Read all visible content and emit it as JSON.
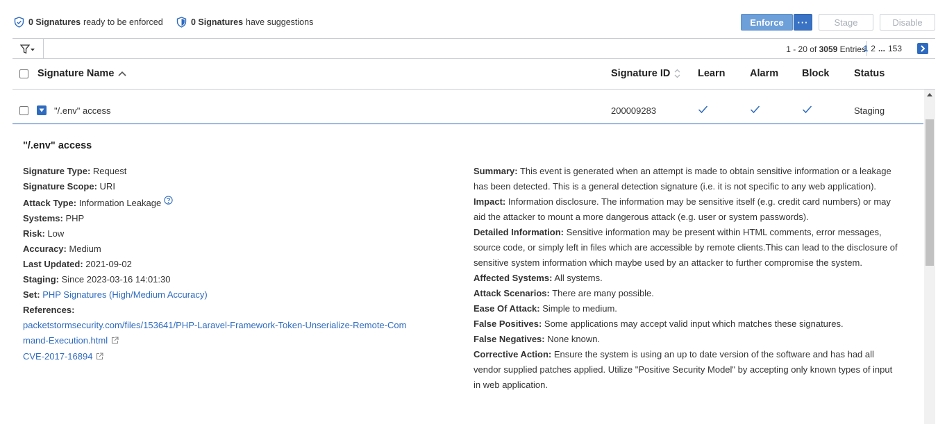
{
  "summary": {
    "ready_count": "0 Signatures",
    "ready_text": "ready to be enforced",
    "suggest_count": "0 Signatures",
    "suggest_text": "have suggestions"
  },
  "toolbar": {
    "enforce_label": "Enforce",
    "more_label": "···",
    "stage_label": "Stage",
    "disable_label": "Disable"
  },
  "pagination": {
    "range": "1 - 20 of",
    "total": "3059",
    "entries_label": "Entries",
    "pages": [
      "1",
      "2",
      "...",
      "153"
    ],
    "current_page": "1"
  },
  "columns": {
    "name": "Signature Name",
    "id": "Signature ID",
    "learn": "Learn",
    "alarm": "Alarm",
    "block": "Block",
    "status": "Status"
  },
  "row": {
    "name": "\"/.env\" access",
    "id": "200009283",
    "learn": true,
    "alarm": true,
    "block": true,
    "status": "Staging"
  },
  "details": {
    "title": "\"/.env\" access",
    "left": [
      {
        "label": "Signature Type:",
        "value": "Request"
      },
      {
        "label": "Signature Scope:",
        "value": "URI"
      },
      {
        "label": "Attack Type:",
        "value": "Information Leakage"
      },
      {
        "label": "Systems:",
        "value": "PHP"
      },
      {
        "label": "Risk:",
        "value": "Low"
      },
      {
        "label": "Accuracy:",
        "value": "Medium"
      },
      {
        "label": "Last Updated:",
        "value": "2021-09-02"
      },
      {
        "label": "Staging:",
        "value": "Since 2023-03-16 14:01:30"
      },
      {
        "label": "Set:",
        "value": "PHP Signatures (High/Medium Accuracy)"
      },
      {
        "label": "References:",
        "value": ""
      }
    ],
    "references": [
      "packetstormsecurity.com/files/153641/PHP-Laravel-Framework-Token-Unserialize-Remote-Command-Execution.html",
      "CVE-2017-16894"
    ],
    "right": [
      {
        "label": "Summary:",
        "value": "This event is generated when an attempt is made to obtain sensitive information or a leakage has been detected. This is a general detection signature (i.e. it is not specific to any web application)."
      },
      {
        "label": "Impact:",
        "value": "Information disclosure. The information may be sensitive itself (e.g. credit card numbers) or may aid the attacker to mount a more dangerous attack (e.g. user or system passwords)."
      },
      {
        "label": "Detailed Information:",
        "value": "Sensitive information may be present within HTML comments, error messages, source code, or simply left in files which are accessible by remote clients.This can lead to the disclosure of sensitive system information which maybe used by an attacker to further compromise the system."
      },
      {
        "label": "Affected Systems:",
        "value": "All systems."
      },
      {
        "label": "Attack Scenarios:",
        "value": "There are many possible."
      },
      {
        "label": "Ease Of Attack:",
        "value": "Simple to medium."
      },
      {
        "label": "False Positives:",
        "value": "Some applications may accept valid input which matches these signatures."
      },
      {
        "label": "False Negatives:",
        "value": "None known."
      },
      {
        "label": "Corrective Action:",
        "value": "Ensure the system is using an up to date version of the software and has had all vendor supplied patches applied. Utilize \"Positive Security Model\" by accepting only known types of input in web application."
      }
    ]
  },
  "colors": {
    "accent": "#2e6bbf",
    "enforce_button": "#6d9fd8",
    "text": "#333333"
  }
}
